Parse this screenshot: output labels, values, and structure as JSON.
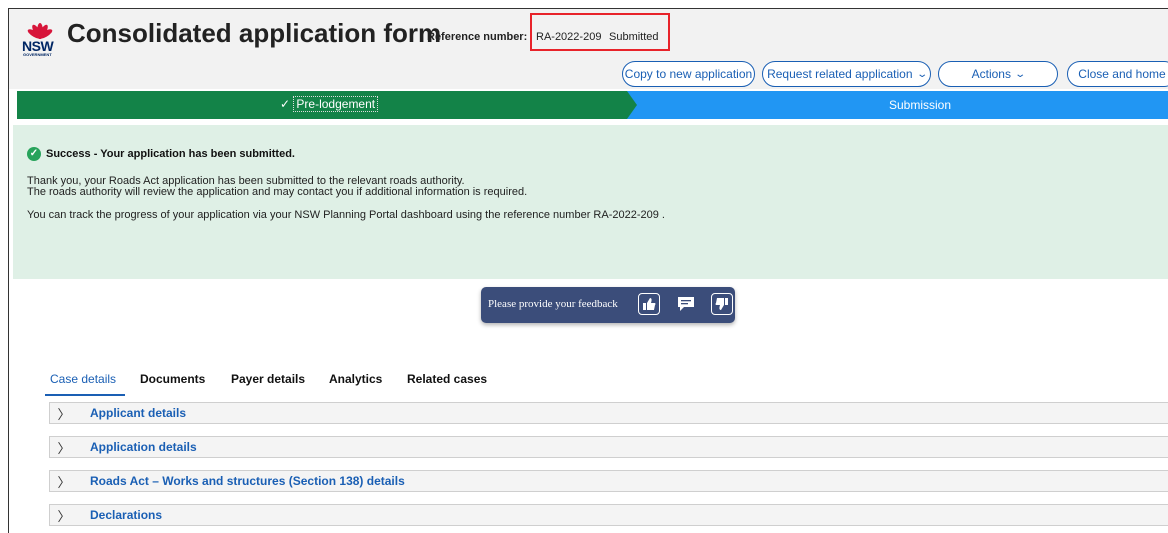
{
  "header": {
    "logo_text": "NSW",
    "logo_subtext": "GOVERNMENT",
    "title": "Consolidated application form",
    "reference_label": "Reference number:",
    "reference_number": "RA-2022-209",
    "status": "Submitted",
    "buttons": {
      "copy": "Copy to new application",
      "request": "Request related application",
      "actions": "Actions",
      "close": "Close and home"
    }
  },
  "progress": {
    "steps": [
      {
        "label": "Pre-lodgement",
        "state": "complete"
      },
      {
        "label": "Submission",
        "state": "current"
      }
    ]
  },
  "success": {
    "heading": "Success - Your application has been submitted.",
    "line1": "Thank you, your Roads Act application has been submitted to the relevant roads authority.",
    "line2": "The roads authority will review the application and may contact you if additional information is required.",
    "line3": "You can track the progress of your application via your NSW Planning Portal dashboard using the reference number RA-2022-209 ."
  },
  "feedback": {
    "prompt": "Please provide your feedback"
  },
  "tabs": [
    {
      "label": "Case details",
      "active": true
    },
    {
      "label": "Documents",
      "active": false
    },
    {
      "label": "Payer details",
      "active": false
    },
    {
      "label": "Analytics",
      "active": false
    },
    {
      "label": "Related cases",
      "active": false
    }
  ],
  "sections": [
    {
      "label": "Applicant details"
    },
    {
      "label": "Application details"
    },
    {
      "label": "Roads Act – Works and structures (Section 138) details"
    },
    {
      "label": "Declarations"
    }
  ],
  "colors": {
    "accent": "#1a5fb4",
    "progress_done": "#138348",
    "progress_current": "#2196f3",
    "success_bg": "#dff0e6",
    "highlight_box": "#e8232a",
    "feedback_bg": "#3b4d7a"
  }
}
